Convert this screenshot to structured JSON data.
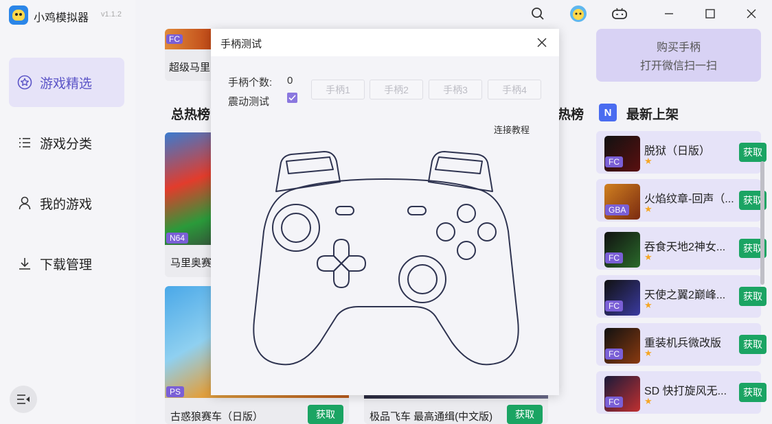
{
  "app": {
    "title": "小鸡模拟器",
    "version": "v1.1.2"
  },
  "sidebar": {
    "items": [
      {
        "label": "游戏精选",
        "icon": "star-circle-icon",
        "active": true
      },
      {
        "label": "游戏分类",
        "icon": "list-icon",
        "active": false
      },
      {
        "label": "我的游戏",
        "icon": "user-icon",
        "active": false
      },
      {
        "label": "下载管理",
        "icon": "download-icon",
        "active": false
      }
    ]
  },
  "main": {
    "top_card": {
      "tag": "FC",
      "title": "超级马里"
    },
    "section_hot": "总热榜",
    "section_hot_right": "热榜",
    "cards": [
      {
        "tag": "N64",
        "title": "马里奥赛"
      },
      {
        "tag": "PS",
        "title": "古惑狼赛车（日版）",
        "button": "获取"
      },
      {
        "tag": "",
        "title": "极品飞车 最高通缉(中文版)",
        "button": "获取"
      }
    ]
  },
  "right_panel": {
    "buy": {
      "line1": "购买手柄",
      "line2": "打开微信扫一扫"
    },
    "section_new": "最新上架",
    "items": [
      {
        "tag": "FC",
        "name": "脱狱（日版）",
        "button": "获取"
      },
      {
        "tag": "GBA",
        "name": "火焰纹章-回声（...",
        "button": "获取"
      },
      {
        "tag": "FC",
        "name": "吞食天地2神女...",
        "button": "获取"
      },
      {
        "tag": "FC",
        "name": "天使之翼2巅峰...",
        "button": "获取"
      },
      {
        "tag": "FC",
        "name": "重装机兵微改版",
        "button": "获取"
      },
      {
        "tag": "FC",
        "name": "SD 快打旋风无...",
        "button": "获取"
      }
    ]
  },
  "dialog": {
    "title": "手柄测试",
    "count_label": "手柄个数:",
    "count_value": "0",
    "vibration_label": "震动测试",
    "vibration_checked": true,
    "pad_buttons": [
      "手柄1",
      "手柄2",
      "手柄3",
      "手柄4"
    ],
    "tutorial_link": "连接教程"
  },
  "colors": {
    "accent": "#7a5fd6",
    "get_button": "#1ba463",
    "active_nav_bg": "#e6e3f8"
  }
}
